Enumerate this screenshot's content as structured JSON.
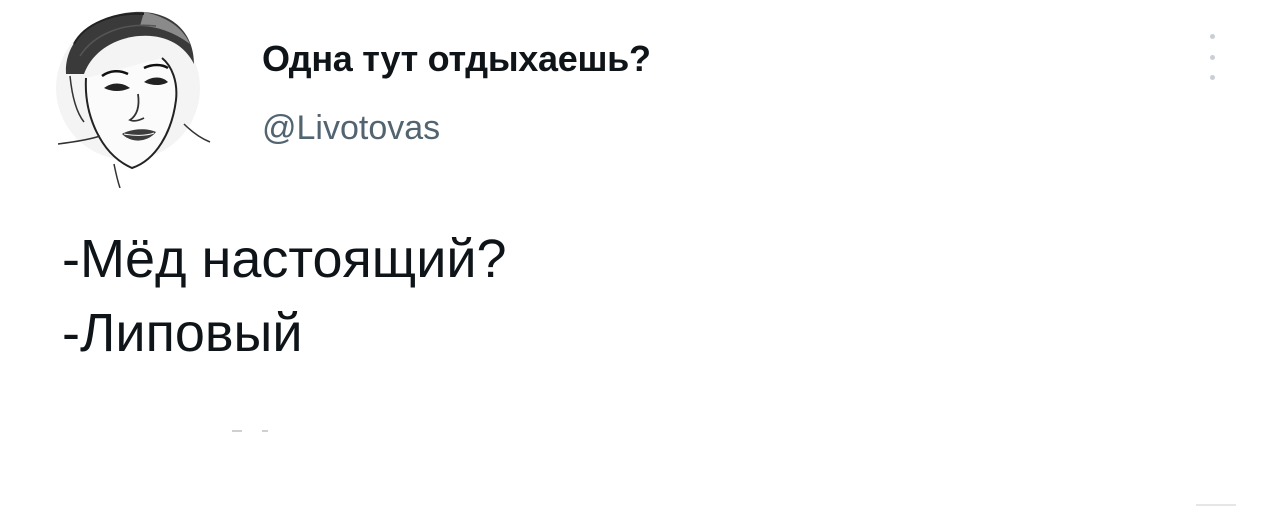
{
  "author": {
    "display_name": "Одна тут отдыхаешь?",
    "handle": "@Livotovas",
    "avatar_icon": "illustrated-woman-portrait"
  },
  "menu": {
    "icon": "more-vertical-icon"
  },
  "tweet": {
    "lines": [
      "-Мёд настоящий?",
      "-Липовый"
    ]
  },
  "colors": {
    "text_primary": "#0f1419",
    "text_secondary": "#536471",
    "background": "#ffffff",
    "menu_dots": "#c9cfd4"
  }
}
